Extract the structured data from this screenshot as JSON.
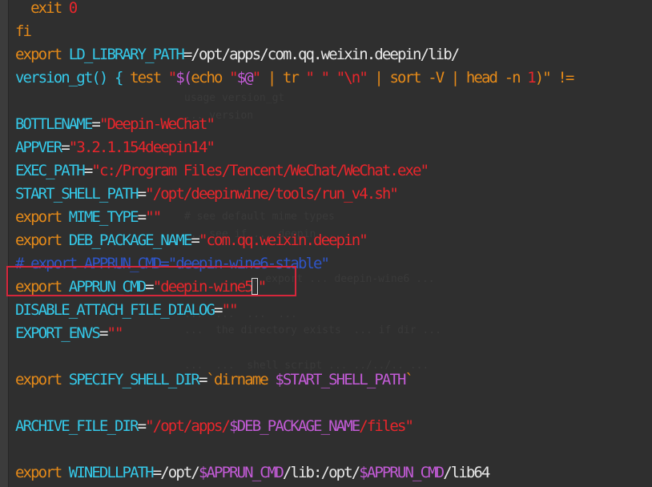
{
  "colors": {
    "background": "#2f2f2f",
    "keyword": "#e58a19",
    "identifier": "#35c8e8",
    "string": "#e8262c",
    "plain": "#e8e8e8",
    "variable": "#c25bd6",
    "comment": "#2f55c7",
    "highlight_border": "#d6263b",
    "ghost_text": "#3a3a3a"
  },
  "highlight": {
    "line_index": 12,
    "caption": "Highlighted line: export APPRUN_CMD=\"deepin-wine5\""
  },
  "cursor": {
    "line_index": 12
  },
  "lines": [
    {
      "tokens": [
        {
          "t": "  exit ",
          "c": "keyword"
        },
        {
          "t": "0",
          "c": "string"
        }
      ]
    },
    {
      "tokens": [
        {
          "t": "fi",
          "c": "keyword"
        }
      ]
    },
    {
      "tokens": [
        {
          "t": "export ",
          "c": "keyword"
        },
        {
          "t": "LD_LIBRARY_PATH",
          "c": "identifier"
        },
        {
          "t": "=/opt/apps/com.qq.weixin.deepin/lib/",
          "c": "plain"
        }
      ]
    },
    {
      "tokens": [
        {
          "t": "version_gt",
          "c": "identifier"
        },
        {
          "t": "() { ",
          "c": "identifier"
        },
        {
          "t": "test ",
          "c": "keyword"
        },
        {
          "t": "\"",
          "c": "string"
        },
        {
          "t": "$(",
          "c": "variable"
        },
        {
          "t": "echo ",
          "c": "keyword"
        },
        {
          "t": "\"",
          "c": "string"
        },
        {
          "t": "$@",
          "c": "variable"
        },
        {
          "t": "\"",
          "c": "string"
        },
        {
          "t": " | ",
          "c": "keyword"
        },
        {
          "t": "tr ",
          "c": "keyword"
        },
        {
          "t": "\" \" \"\\n\"",
          "c": "string"
        },
        {
          "t": " | ",
          "c": "keyword"
        },
        {
          "t": "sort ",
          "c": "keyword"
        },
        {
          "t": "-V",
          "c": "keyword"
        },
        {
          "t": " | ",
          "c": "keyword"
        },
        {
          "t": "head ",
          "c": "keyword"
        },
        {
          "t": "-n ",
          "c": "keyword"
        },
        {
          "t": "1",
          "c": "string"
        },
        {
          "t": ")\" !=",
          "c": "keyword"
        }
      ]
    },
    {
      "tokens": []
    },
    {
      "tokens": [
        {
          "t": "BOTTLENAME",
          "c": "identifier"
        },
        {
          "t": "=",
          "c": "plain"
        },
        {
          "t": "\"Deepin-WeChat\"",
          "c": "string"
        }
      ]
    },
    {
      "tokens": [
        {
          "t": "APPVER",
          "c": "identifier"
        },
        {
          "t": "=",
          "c": "plain"
        },
        {
          "t": "\"3.2.1.154deepin14\"",
          "c": "string"
        }
      ]
    },
    {
      "tokens": [
        {
          "t": "EXEC_PATH",
          "c": "identifier"
        },
        {
          "t": "=",
          "c": "plain"
        },
        {
          "t": "\"c:/Program Files/Tencent/WeChat/WeChat.exe\"",
          "c": "string"
        }
      ]
    },
    {
      "tokens": [
        {
          "t": "START_SHELL_PATH",
          "c": "identifier"
        },
        {
          "t": "=",
          "c": "plain"
        },
        {
          "t": "\"/opt/deepinwine/tools/run_v4.sh\"",
          "c": "string"
        }
      ]
    },
    {
      "tokens": [
        {
          "t": "export ",
          "c": "keyword"
        },
        {
          "t": "MIME_TYPE",
          "c": "identifier"
        },
        {
          "t": "=",
          "c": "plain"
        },
        {
          "t": "\"\"",
          "c": "string"
        }
      ]
    },
    {
      "tokens": [
        {
          "t": "export ",
          "c": "keyword"
        },
        {
          "t": "DEB_PACKAGE_NAME",
          "c": "identifier"
        },
        {
          "t": "=",
          "c": "plain"
        },
        {
          "t": "\"com.qq.weixin.deepin\"",
          "c": "string"
        }
      ]
    },
    {
      "tokens": [
        {
          "t": "# export APPRUN_CMD=\"deepin-wine6-stable\"",
          "c": "comment"
        }
      ]
    },
    {
      "tokens": [
        {
          "t": "export ",
          "c": "keyword"
        },
        {
          "t": "APPRUN_CMD",
          "c": "identifier"
        },
        {
          "t": "=",
          "c": "plain"
        },
        {
          "t": "\"deepin-wine5",
          "c": "string"
        },
        {
          "t": "\"",
          "c": "string"
        }
      ]
    },
    {
      "tokens": [
        {
          "t": "DISABLE_ATTACH_FILE_DIALOG",
          "c": "identifier"
        },
        {
          "t": "=",
          "c": "plain"
        },
        {
          "t": "\"\"",
          "c": "string"
        }
      ]
    },
    {
      "tokens": [
        {
          "t": "EXPORT_ENVS",
          "c": "identifier"
        },
        {
          "t": "=",
          "c": "plain"
        },
        {
          "t": "\"\"",
          "c": "string"
        }
      ]
    },
    {
      "tokens": []
    },
    {
      "tokens": [
        {
          "t": "export ",
          "c": "keyword"
        },
        {
          "t": "SPECIFY_SHELL_DIR",
          "c": "identifier"
        },
        {
          "t": "=",
          "c": "plain"
        },
        {
          "t": "`dirname ",
          "c": "keyword"
        },
        {
          "t": "$START_SHELL_PATH",
          "c": "variable"
        },
        {
          "t": "`",
          "c": "keyword"
        }
      ]
    },
    {
      "tokens": []
    },
    {
      "tokens": [
        {
          "t": "ARCHIVE_FILE_DIR",
          "c": "identifier"
        },
        {
          "t": "=",
          "c": "plain"
        },
        {
          "t": "\"/opt/apps/",
          "c": "string"
        },
        {
          "t": "$DEB_PACKAGE_NAME",
          "c": "variable"
        },
        {
          "t": "/files\"",
          "c": "string"
        }
      ]
    },
    {
      "tokens": []
    },
    {
      "tokens": [
        {
          "t": "export ",
          "c": "keyword"
        },
        {
          "t": "WINEDLLPATH",
          "c": "identifier"
        },
        {
          "t": "=/opt/",
          "c": "plain"
        },
        {
          "t": "$APPRUN_CMD",
          "c": "variable"
        },
        {
          "t": "/lib:/opt/",
          "c": "plain"
        },
        {
          "t": "$APPRUN_CMD",
          "c": "variable"
        },
        {
          "t": "/lib64",
          "c": "plain"
        }
      ]
    }
  ],
  "ghost_lines": [
    {
      "text": "usage version_gt"
    },
    {
      "text": "... version"
    },
    {
      "text": "# see default mime types"
    },
    {
      "text": "... see if ... deepin ..."
    },
    {
      "text": "... export ... deepin-wine6 ..."
    },
    {
      "text": "...  ...  ...  ..."
    },
    {
      "text": "...  the directory exists  ... if dir ..."
    },
    {
      "text": "...  ...  shell script ... ../../.. ..."
    }
  ]
}
